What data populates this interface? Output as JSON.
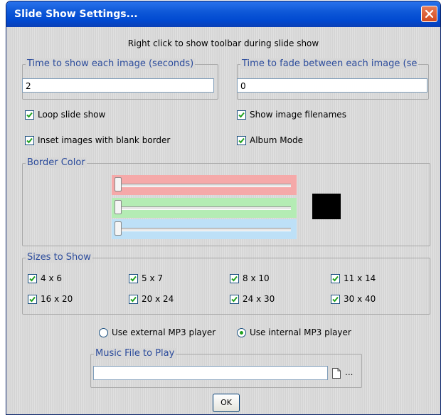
{
  "window": {
    "title": "Slide Show Settings..."
  },
  "hint": "Right click to show toolbar during slide show",
  "time_show": {
    "label": "Time to show each image (seconds)",
    "value": "2"
  },
  "time_fade": {
    "label": "Time to fade between each image (se",
    "value": "0"
  },
  "options": {
    "loop": {
      "label": "Loop slide show",
      "checked": true
    },
    "filenames": {
      "label": "Show image filenames",
      "checked": true
    },
    "inset": {
      "label": "Inset images with blank border",
      "checked": true
    },
    "album": {
      "label": "Album Mode",
      "checked": true
    }
  },
  "border_color": {
    "label": "Border Color",
    "sliders": [
      {
        "name": "red",
        "band_color": "#f5a9a9",
        "value": 0
      },
      {
        "name": "green",
        "band_color": "#b4ecb4",
        "value": 0
      },
      {
        "name": "blue",
        "band_color": "#bde0f7",
        "value": 0
      }
    ],
    "swatch_color": "#000000"
  },
  "sizes": {
    "label": "Sizes to Show",
    "items": [
      "4 x 6",
      "5 x 7",
      "8 x 10",
      "11 x 14",
      "16 x 20",
      "20 x 24",
      "24 x 30",
      "30 x 40"
    ]
  },
  "player": {
    "external_label": "Use external MP3 player",
    "internal_label": "Use internal MP3 player",
    "selected": "internal"
  },
  "music": {
    "label": "Music File to Play",
    "value": "",
    "browse_label": "..."
  },
  "ok_label": "OK"
}
